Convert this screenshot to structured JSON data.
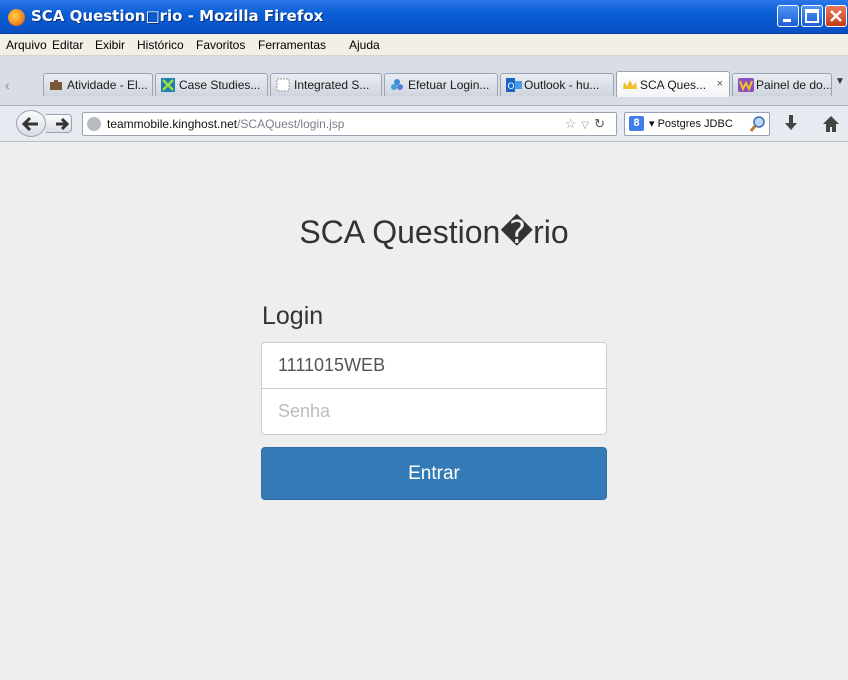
{
  "window": {
    "title": "SCA Question□rio - Mozilla Firefox"
  },
  "menu": [
    "Arquivo",
    "Editar",
    "Exibir",
    "Histórico",
    "Favoritos",
    "Ferramentas",
    "Ajuda"
  ],
  "tabs": [
    {
      "label": "Atividade - El...",
      "icon": "briefcase-icon",
      "active": false
    },
    {
      "label": "Case Studies...",
      "icon": "x-logo-icon",
      "active": false
    },
    {
      "label": "Integrated S...",
      "icon": "blank-page-icon",
      "active": false
    },
    {
      "label": "Efetuar Login...",
      "icon": "flower-icon",
      "active": false
    },
    {
      "label": "Outlook - hu...",
      "icon": "outlook-icon",
      "active": false
    },
    {
      "label": "SCA Ques...",
      "icon": "crown-icon",
      "active": true,
      "close": "×"
    },
    {
      "label": "Painel de do...",
      "icon": "wordpress-icon",
      "active": false
    }
  ],
  "navbar": {
    "url_host": "teammobile.kinghost.net",
    "url_path": "/SCAQuest/login.jsp",
    "search_engine": "Postgres JDBC"
  },
  "page": {
    "title": "SCA Question�rio",
    "login_heading": "Login",
    "username_value": "1111015WEB",
    "password_placeholder": "Senha",
    "submit_label": "Entrar"
  },
  "colors": {
    "primary_button": "#337ab7",
    "background": "#eeeeee"
  }
}
